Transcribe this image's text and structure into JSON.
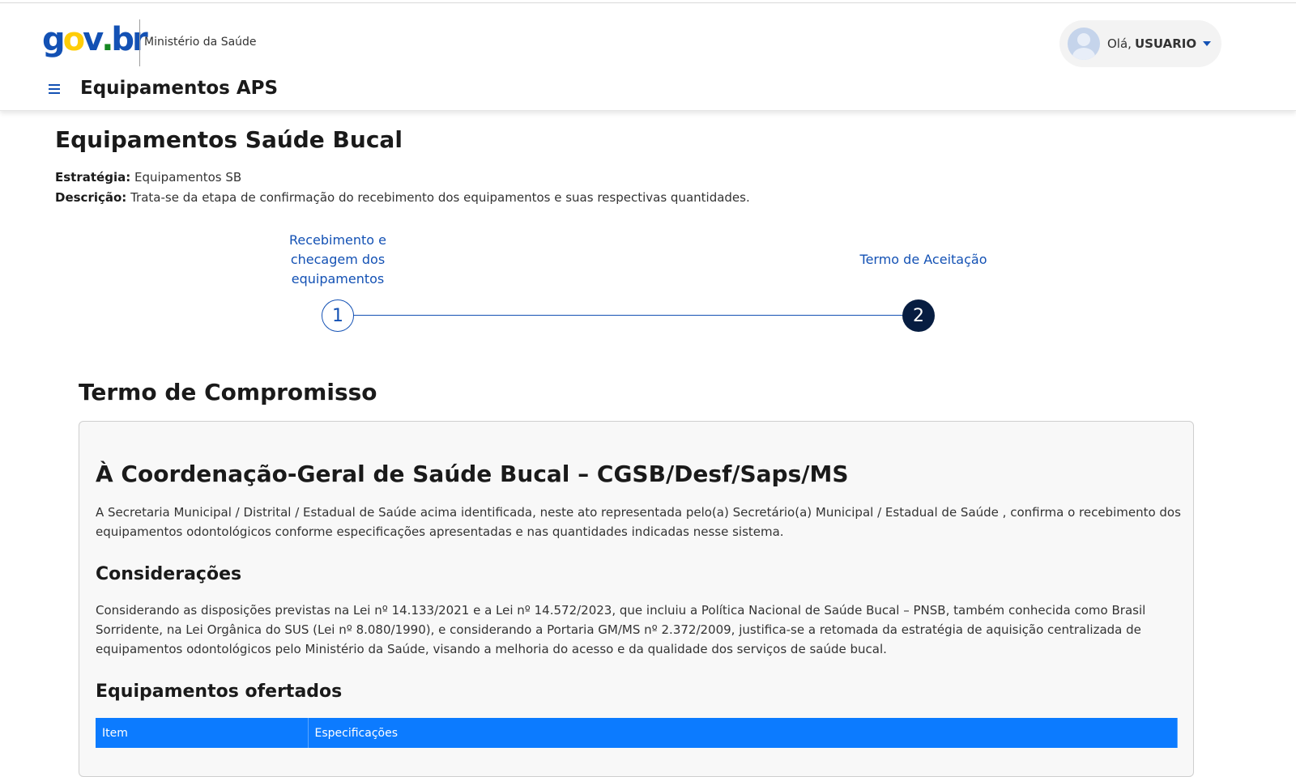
{
  "header": {
    "logo_text": "gov.br",
    "ministry": "Ministério da Saúde",
    "app_title": "Equipamentos APS",
    "user": {
      "greeting": "Olá,",
      "name": "USUARIO"
    }
  },
  "page": {
    "title": "Equipamentos Saúde Bucal",
    "strategy_label": "Estratégia:",
    "strategy_value": "Equipamentos SB",
    "description_label": "Descrição:",
    "description_value": "Trata-se da etapa de confirmação do recebimento dos equipamentos e suas respectivas quantidades."
  },
  "stepper": {
    "steps": [
      {
        "number": "1",
        "label": "Recebimento e checagem dos equipamentos"
      },
      {
        "number": "2",
        "label": "Termo de Aceitação"
      }
    ]
  },
  "term": {
    "section_title": "Termo de Compromisso",
    "heading": "À Coordenação-Geral de Saúde Bucal – CGSB/Desf/Saps/MS",
    "intro": "A Secretaria Municipal / Distrital / Estadual de Saúde acima identificada, neste ato representada pelo(a) Secretário(a) Municipal / Estadual de Saúde , confirma o recebimento dos equipamentos odontológicos conforme especificações apresentadas e nas quantidades indicadas nesse sistema.",
    "considerations_title": "Considerações",
    "considerations_text": "Considerando as disposições previstas na Lei nº 14.133/2021 e a Lei nº 14.572/2023, que incluiu a Política Nacional de Saúde Bucal – PNSB, também conhecida como Brasil Sorridente, na Lei Orgânica do SUS (Lei nº 8.080/1990), e considerando a Portaria GM/MS nº 2.372/2009, justifica-se a retomada da estratégia de aquisição centralizada de equipamentos odontológicos pelo Ministério da Saúde, visando a melhoria do acesso e da qualidade dos serviços de saúde bucal.",
    "equipment_title": "Equipamentos ofertados",
    "table_headers": [
      "Item",
      "Especificações"
    ]
  },
  "colors": {
    "primary": "#1351b4",
    "table_header": "#0c7bff",
    "step_active": "#071d41"
  }
}
